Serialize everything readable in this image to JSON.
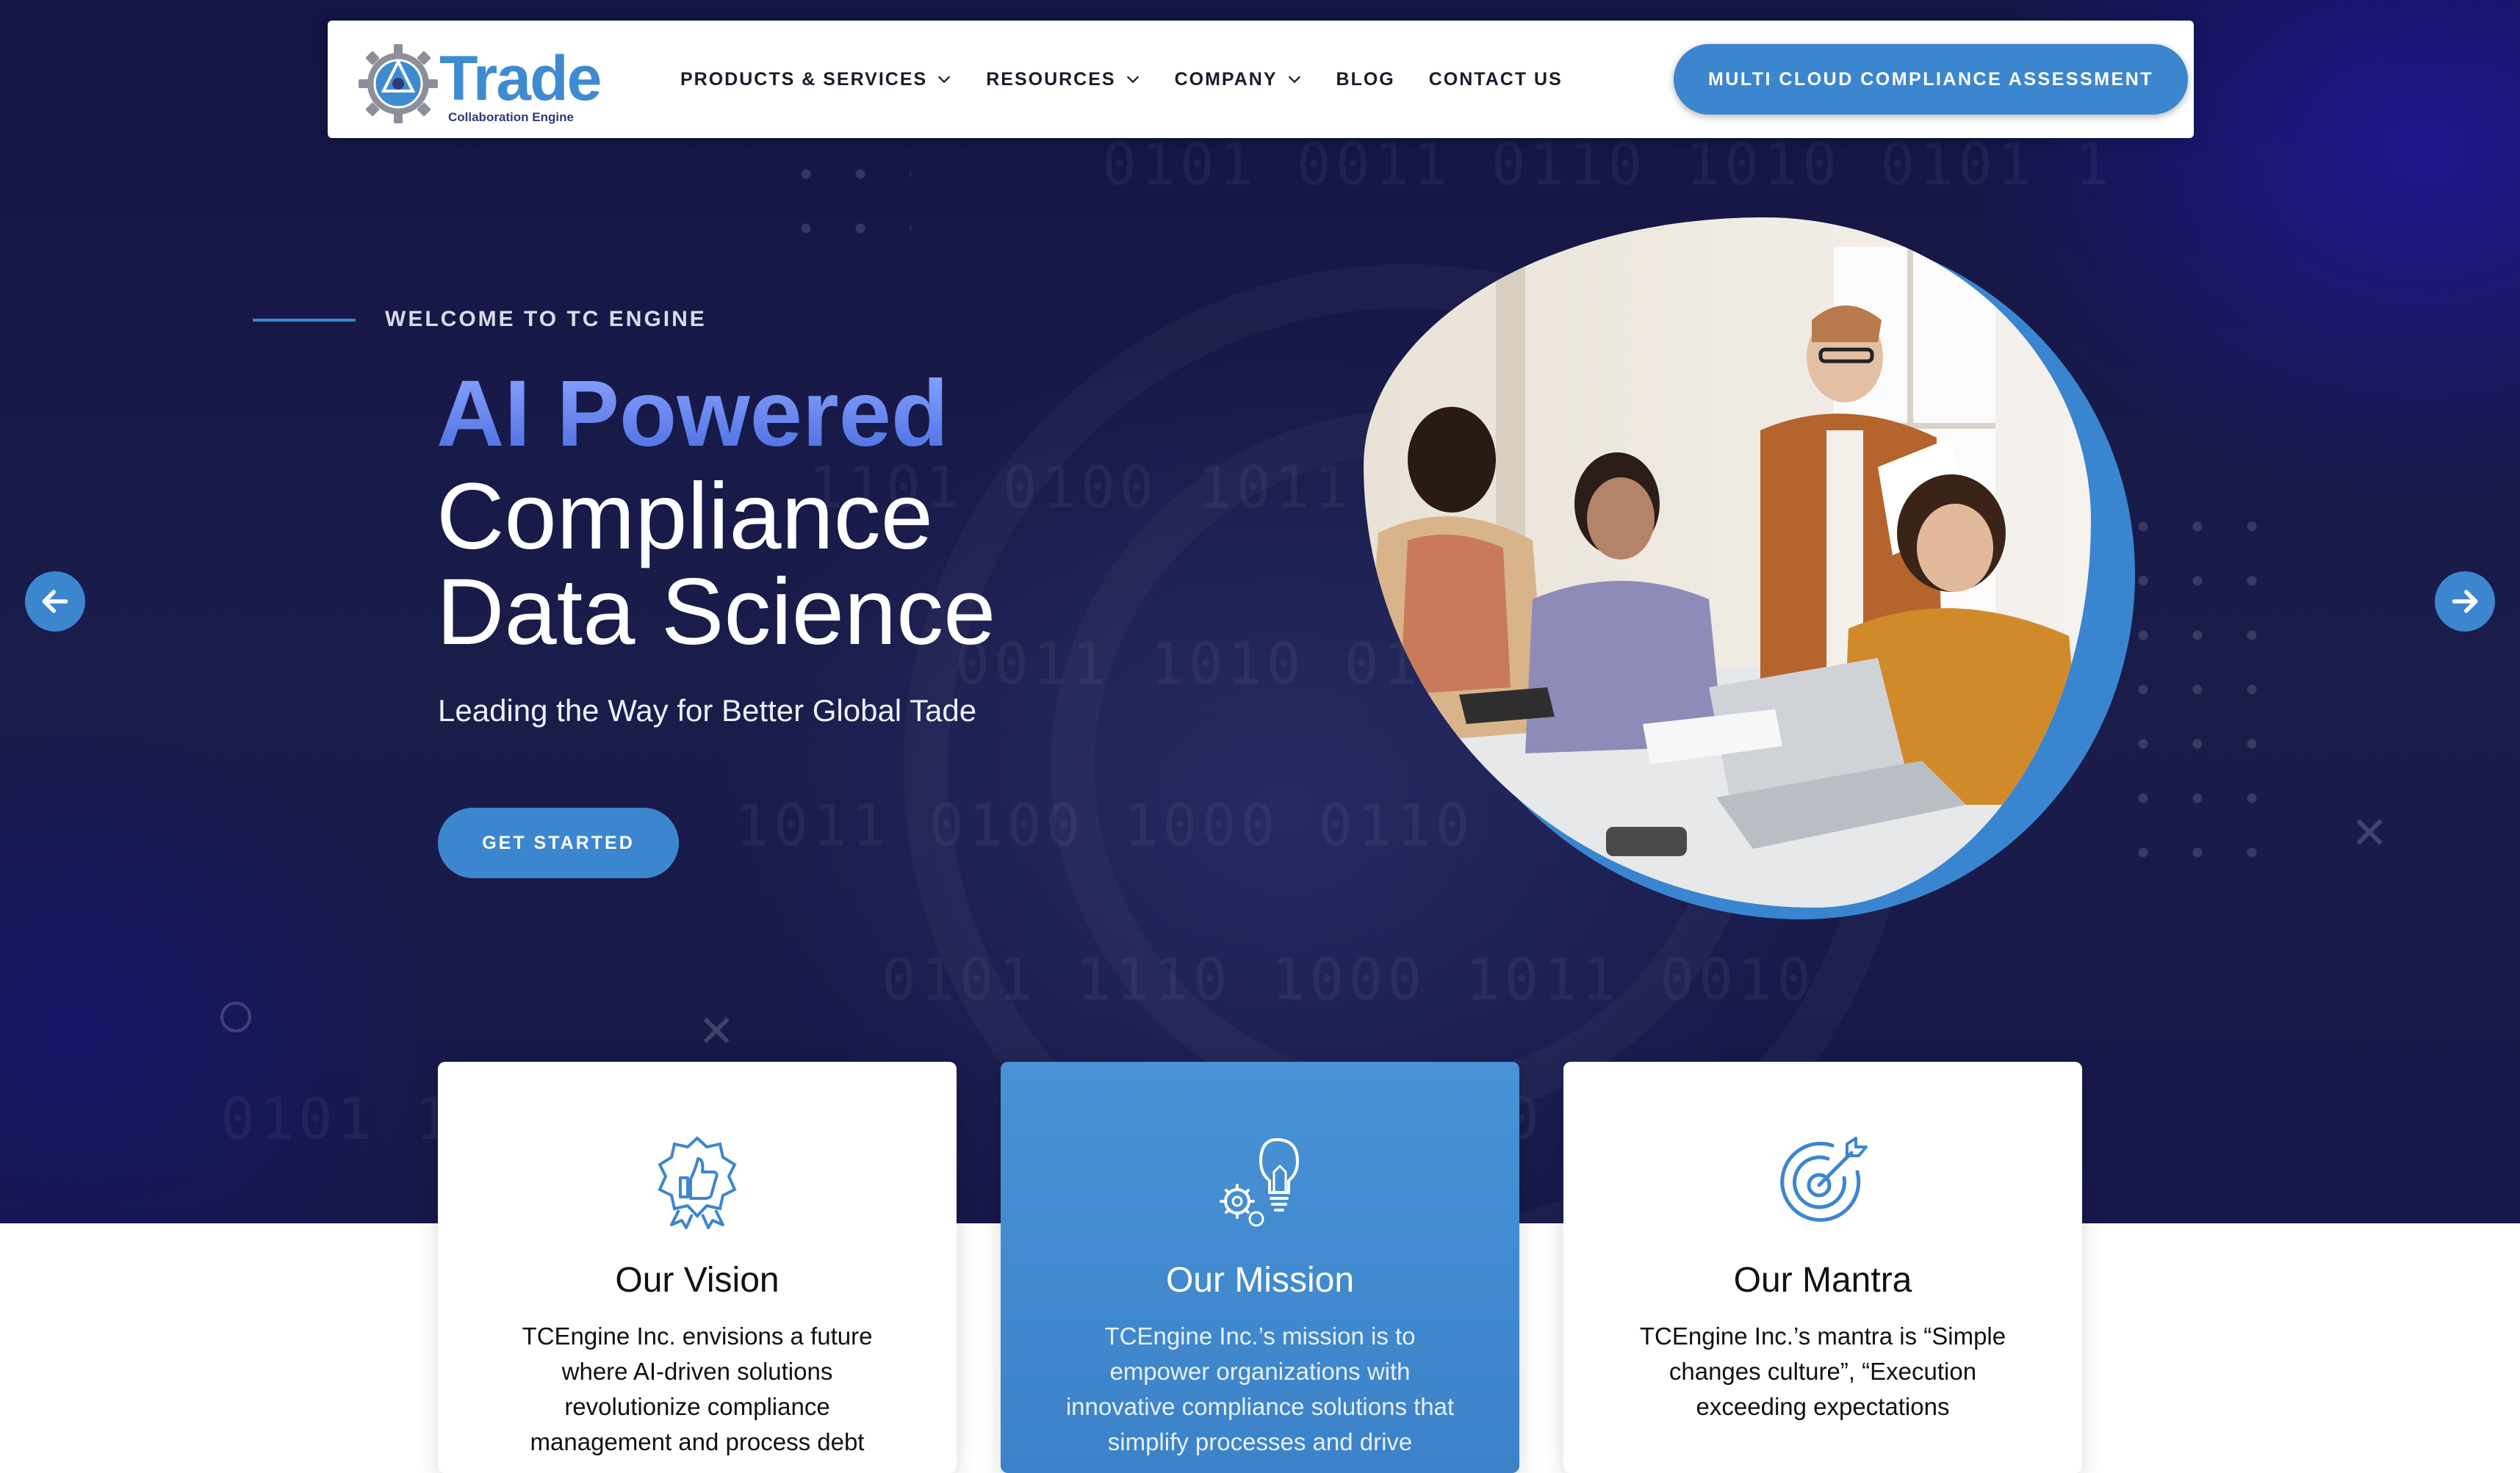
{
  "nav": {
    "logo_word": "Trade",
    "logo_sub": "Collaboration Engine",
    "items": [
      {
        "label": "PRODUCTS & SERVICES",
        "dropdown": true
      },
      {
        "label": "RESOURCES",
        "dropdown": true
      },
      {
        "label": "COMPANY",
        "dropdown": true
      },
      {
        "label": "BLOG",
        "dropdown": false
      },
      {
        "label": "CONTACT US",
        "dropdown": false
      }
    ],
    "cta_label": "MULTI CLOUD COMPLIANCE ASSESSMENT"
  },
  "hero": {
    "eyebrow": "WELCOME TO TC ENGINE",
    "headline_1": "AI Powered",
    "headline_2": "Compliance",
    "headline_3": "Data Science",
    "tagline": "Leading the Way for Better Global Tade",
    "button_label": "GET STARTED"
  },
  "cards": [
    {
      "title": "Our Vision",
      "body": "TCEngine Inc. envisions a future where AI-driven solutions revolutionize compliance management and process debt",
      "icon": "thumbs-up-badge-icon"
    },
    {
      "title": "Our Mission",
      "body": "TCEngine Inc.’s mission is to empower organizations with innovative compliance solutions that simplify processes and drive",
      "icon": "lightbulb-gears-icon"
    },
    {
      "title": "Our Mantra",
      "body": "TCEngine Inc.’s mantra is “Simple changes culture”, “Execution exceeding expectations",
      "icon": "target-dart-icon"
    }
  ],
  "colors": {
    "accent": "#3c86cf",
    "hero_bg": "#16174a",
    "headline_gradient_start": "#8aa4ff"
  }
}
